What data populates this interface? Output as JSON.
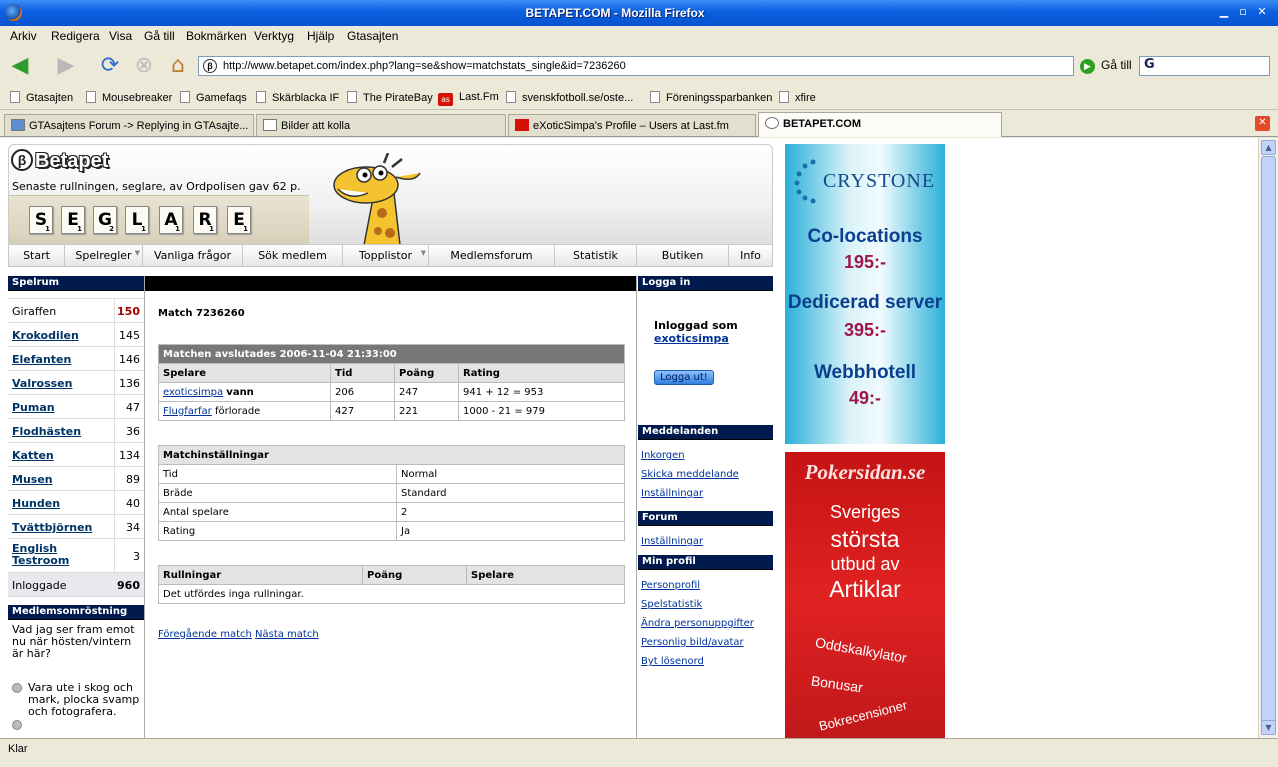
{
  "window": {
    "title": "BETAPET.COM - Mozilla Firefox"
  },
  "menu": [
    "Arkiv",
    "Redigera",
    "Visa",
    "Gå till",
    "Bokmärken",
    "Verktyg",
    "Hjälp",
    "Gtasajten"
  ],
  "nav": {
    "url": "http://www.betapet.com/index.php?lang=se&show=matchstats_single&id=7236260",
    "go_label": "Gå till",
    "search_glyph": "G"
  },
  "bookmarks": [
    "Gtasajten",
    "Mousebreaker",
    "Gamefaqs",
    "Skärblacka IF",
    "The PirateBay",
    "Last.Fm",
    "svenskfotboll.se/oste...",
    "Föreningssparbanken",
    "xfire"
  ],
  "tabs": [
    "GTAsajtens Forum -> Replying in GTAsajte...",
    "Bilder att kolla",
    "eXoticSimpa's Profile – Users at Last.fm",
    "BETAPET.COM"
  ],
  "status": "Klar",
  "page": {
    "logo": "Betapet",
    "logo_glyph": "β",
    "tagline": "Senaste rullningen, seglare, av Ordpolisen gav 62 p.",
    "tiles": [
      {
        "l": "S",
        "s": "1"
      },
      {
        "l": "E",
        "s": "1"
      },
      {
        "l": "G",
        "s": "2"
      },
      {
        "l": "L",
        "s": "1"
      },
      {
        "l": "A",
        "s": "1"
      },
      {
        "l": "R",
        "s": "1"
      },
      {
        "l": "E",
        "s": "1"
      }
    ],
    "menu": [
      "Start",
      "Spelregler",
      "Vanliga frågor",
      "Sök medlem",
      "Topplistor",
      "Medlemsforum",
      "Statistik",
      "Butiken",
      "Info"
    ],
    "left": {
      "header": "Spelrum",
      "rooms": [
        {
          "name": "Giraffen",
          "count": "150"
        },
        {
          "name": "Krokodilen",
          "count": "145"
        },
        {
          "name": "Elefanten",
          "count": "146"
        },
        {
          "name": "Valrossen",
          "count": "136"
        },
        {
          "name": "Puman",
          "count": "47"
        },
        {
          "name": "Flodhästen",
          "count": "36"
        },
        {
          "name": "Katten",
          "count": "134"
        },
        {
          "name": "Musen",
          "count": "89"
        },
        {
          "name": "Hunden",
          "count": "40"
        },
        {
          "name": "Tvättbjörnen",
          "count": "34"
        },
        {
          "name": "English Testroom",
          "count": "3"
        }
      ],
      "online_label": "Inloggade",
      "online_count": "960",
      "poll_header": "Medlemsomröstning",
      "poll_question": "Vad jag ser fram emot nu när hösten/vintern är här?",
      "poll_option": "Vara ute i skog och mark, plocka svamp och fotografera."
    },
    "mid": {
      "match_title": "Match 7236260",
      "result_caption": "Matchen avslutades 2006-11-04 21:33:00",
      "result_headers": [
        "Spelare",
        "Tid",
        "Poäng",
        "Rating"
      ],
      "players": [
        {
          "name": "exoticsimpa",
          "outcome": "vann",
          "tid": "206",
          "poang": "247",
          "rating": "941 + 12 = 953"
        },
        {
          "name": "Flugfarfar",
          "outcome": "förlorade",
          "tid": "427",
          "poang": "221",
          "rating": "1000 - 21 = 979"
        }
      ],
      "settings_header": "Matchinställningar",
      "settings": [
        {
          "k": "Tid",
          "v": "Normal"
        },
        {
          "k": "Bräde",
          "v": "Standard"
        },
        {
          "k": "Antal spelare",
          "v": "2"
        },
        {
          "k": "Rating",
          "v": "Ja"
        }
      ],
      "roll_headers": [
        "Rullningar",
        "Poäng",
        "Spelare"
      ],
      "roll_empty": "Det utfördes inga rullningar.",
      "prev_link": "Föregående match",
      "next_link": "Nästa match"
    },
    "right": {
      "login_header": "Logga in",
      "logged_in_as": "Inloggad som",
      "username": "exoticsimpa",
      "logout": "Logga ut!",
      "messages_header": "Meddelanden",
      "messages_links": [
        "Inkorgen",
        "Skicka meddelande",
        "Inställningar"
      ],
      "forum_header": "Forum",
      "forum_links": [
        "Inställningar"
      ],
      "profile_header": "Min profil",
      "profile_links": [
        "Personprofil",
        "Spelstatistik",
        "Ändra personuppgifter",
        "Personlig bild/avatar",
        "Byt lösenord"
      ]
    },
    "ads": {
      "ad1": {
        "brand": "CRYSTONE",
        "l1": "Co-locations",
        "p1": "195:-",
        "l2": "Dedicerad server",
        "p2": "395:-",
        "l3": "Webbhotell",
        "p3": "49:-"
      },
      "ad2": {
        "brand": "Pokersidan.se",
        "l1": "Sveriges",
        "l2": "största",
        "l3": "utbud av",
        "l4": "Artiklar",
        "t1": "Oddskalkylator",
        "t2": "Bonusar",
        "t3": "Bokrecensioner"
      }
    }
  }
}
